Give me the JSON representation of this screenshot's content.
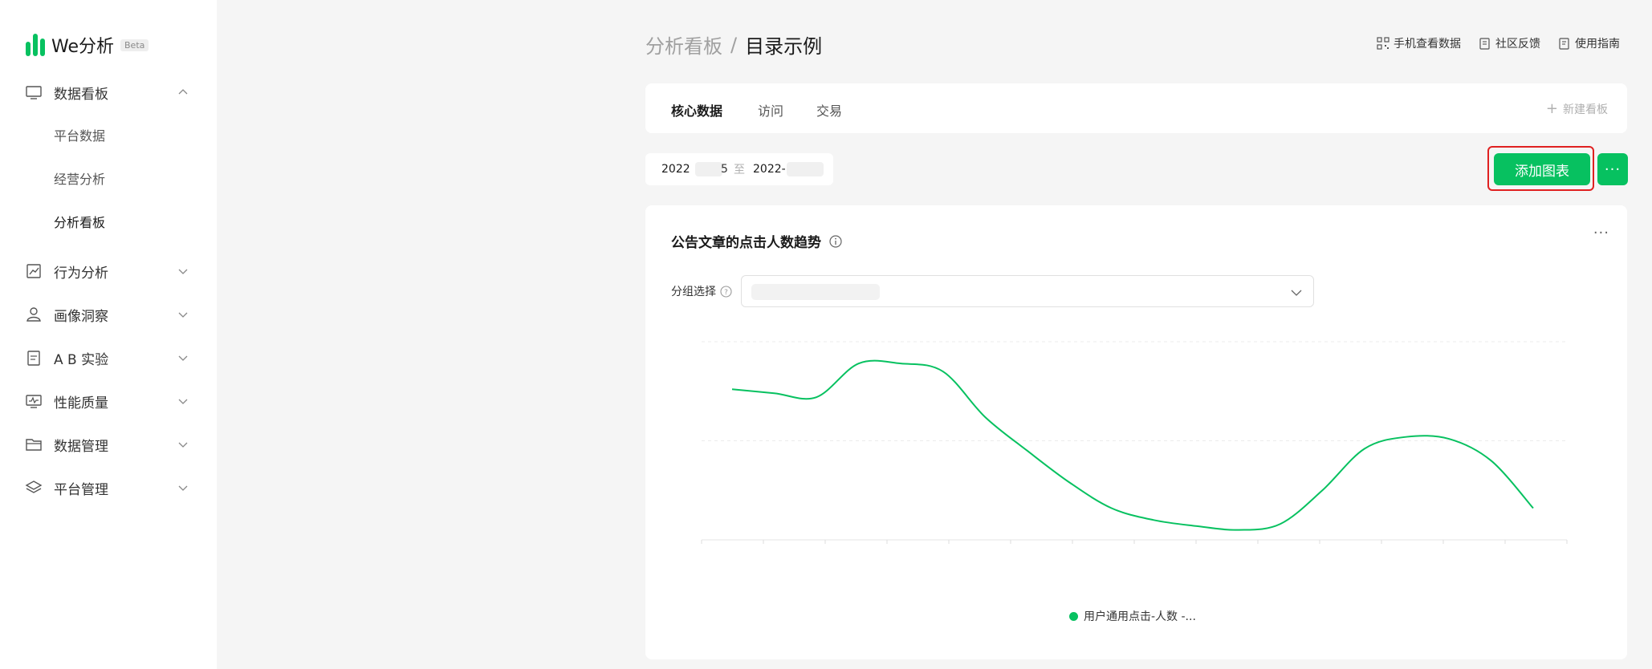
{
  "app": {
    "name": "We分析",
    "badge": "Beta",
    "brand_color": "#07c160"
  },
  "sidebar": {
    "items": [
      {
        "label": "数据看板",
        "icon": "monitor-icon",
        "expanded": true,
        "children": [
          {
            "label": "平台数据"
          },
          {
            "label": "经营分析"
          },
          {
            "label": "分析看板",
            "active": true
          }
        ]
      },
      {
        "label": "行为分析",
        "icon": "line-chart-icon"
      },
      {
        "label": "画像洞察",
        "icon": "user-icon"
      },
      {
        "label": "A B 实验",
        "icon": "clipboard-icon"
      },
      {
        "label": "性能质量",
        "icon": "performance-monitor-icon"
      },
      {
        "label": "数据管理",
        "icon": "folder-icon"
      },
      {
        "label": "平台管理",
        "icon": "layers-icon"
      }
    ]
  },
  "header": {
    "breadcrumb_parent": "分析看板",
    "breadcrumb_sep": "/",
    "breadcrumb_current": "目录示例",
    "links": [
      "手机查看数据",
      "社区反馈",
      "使用指南"
    ]
  },
  "tabs": [
    "核心数据",
    "访问",
    "交易"
  ],
  "new_board": {
    "plus": "+",
    "label": "新建看板"
  },
  "date_range": {
    "start": "2022",
    "start_tail": "5",
    "to": "至",
    "end": "2022-"
  },
  "actions": {
    "add_chart": "添加图表",
    "more": "···"
  },
  "chart_card": {
    "title": "公告文章的点击人数趋势",
    "more": "···",
    "group_label": "分组选择",
    "group_value": ""
  },
  "chart_data": {
    "type": "line",
    "title": "公告文章的点击人数趋势",
    "xlabel": "",
    "ylabel": "",
    "ylim": [
      0,
      100
    ],
    "grid": true,
    "legend_position": "bottom",
    "series": [
      {
        "name": "用户通用点击-人数 -...",
        "color": "#07c160",
        "values": [
          76,
          74,
          72,
          89,
          89,
          85,
          62,
          45,
          29,
          16,
          10,
          7,
          5,
          8,
          25,
          46,
          52,
          51,
          40,
          16
        ]
      }
    ]
  }
}
